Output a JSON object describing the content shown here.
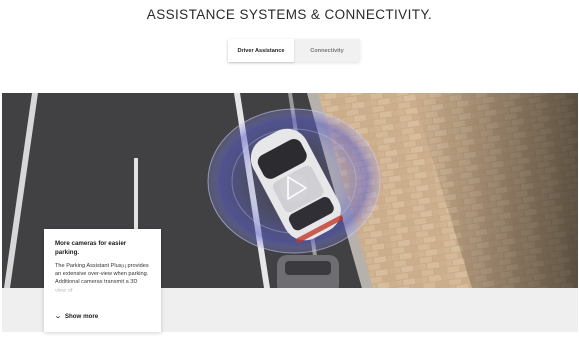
{
  "page": {
    "title": "ASSISTANCE SYSTEMS & CONNECTIVITY."
  },
  "tabs": [
    {
      "label": "Driver Assistance",
      "active": true
    },
    {
      "label": "Connectivity",
      "active": false
    }
  ],
  "video": {
    "play_icon": "play-icon"
  },
  "card": {
    "title": "More cameras for easier parking.",
    "text_before_sup": "The Parking Assistant Plus",
    "sup": "[1]",
    "text_after_sup": " provides an extensive over-view when parking. Additional cameras transmit a 3D view of",
    "show_more_label": "Show more",
    "show_more_icon": "chevron-down-icon"
  }
}
